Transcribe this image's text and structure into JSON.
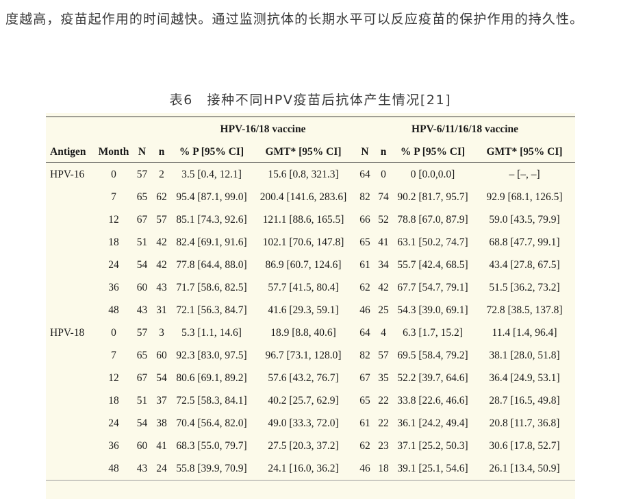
{
  "paragraph": "度越高，疫苗起作用的时间越快。通过监测抗体的长期水平可以反应疫苗的保护作用的持久性。",
  "caption": "表6　接种不同HPV疫苗后抗体产生情况[21]",
  "table": {
    "group_headers": [
      "HPV-16/18 vaccine",
      "HPV-6/11/16/18 vaccine"
    ],
    "columns": [
      "Antigen",
      "Month",
      "N",
      "n",
      "% P [95% CI]",
      "GMT* [95% CI]",
      "N",
      "n",
      "% P [95% CI]",
      "GMT* [95% CI]"
    ],
    "rows": [
      [
        "HPV-16",
        "0",
        "57",
        "2",
        "3.5 [0.4, 12.1]",
        "15.6 [0.8, 321.3]",
        "64",
        "0",
        "0 [0.0,0.0]",
        "– [–, –]"
      ],
      [
        "",
        "7",
        "65",
        "62",
        "95.4 [87.1, 99.0]",
        "200.4 [141.6, 283.6]",
        "82",
        "74",
        "90.2 [81.7, 95.7]",
        "92.9 [68.1, 126.5]"
      ],
      [
        "",
        "12",
        "67",
        "57",
        "85.1 [74.3, 92.6]",
        "121.1 [88.6, 165.5]",
        "66",
        "52",
        "78.8 [67.0, 87.9]",
        "59.0 [43.5, 79.9]"
      ],
      [
        "",
        "18",
        "51",
        "42",
        "82.4 [69.1, 91.6]",
        "102.1 [70.6, 147.8]",
        "65",
        "41",
        "63.1 [50.2, 74.7]",
        "68.8 [47.7, 99.1]"
      ],
      [
        "",
        "24",
        "54",
        "42",
        "77.8 [64.4, 88.0]",
        "86.9 [60.7, 124.6]",
        "61",
        "34",
        "55.7 [42.4, 68.5]",
        "43.4 [27.8, 67.5]"
      ],
      [
        "",
        "36",
        "60",
        "43",
        "71.7 [58.6, 82.5]",
        "57.7 [41.5, 80.4]",
        "62",
        "42",
        "67.7 [54.7, 79.1]",
        "51.5 [36.2, 73.2]"
      ],
      [
        "",
        "48",
        "43",
        "31",
        "72.1 [56.3, 84.7]",
        "41.6 [29.3, 59.1]",
        "46",
        "25",
        "54.3 [39.0, 69.1]",
        "72.8 [38.5, 137.8]"
      ],
      [
        "HPV-18",
        "0",
        "57",
        "3",
        "5.3 [1.1, 14.6]",
        "18.9 [8.8, 40.6]",
        "64",
        "4",
        "6.3 [1.7, 15.2]",
        "11.4 [1.4, 96.4]"
      ],
      [
        "",
        "7",
        "65",
        "60",
        "92.3 [83.0, 97.5]",
        "96.7 [73.1, 128.0]",
        "82",
        "57",
        "69.5 [58.4, 79.2]",
        "38.1 [28.0, 51.8]"
      ],
      [
        "",
        "12",
        "67",
        "54",
        "80.6 [69.1, 89.2]",
        "57.6 [43.2, 76.7]",
        "67",
        "35",
        "52.2 [39.7, 64.6]",
        "36.4 [24.9, 53.1]"
      ],
      [
        "",
        "18",
        "51",
        "37",
        "72.5 [58.3, 84.1]",
        "40.2 [25.7, 62.9]",
        "65",
        "22",
        "33.8 [22.6, 46.6]",
        "28.7 [16.5, 49.8]"
      ],
      [
        "",
        "24",
        "54",
        "38",
        "70.4 [56.4, 82.0]",
        "49.0 [33.3, 72.0]",
        "61",
        "22",
        "36.1 [24.2, 49.4]",
        "20.8 [11.7, 36.8]"
      ],
      [
        "",
        "36",
        "60",
        "41",
        "68.3 [55.0, 79.7]",
        "27.5 [20.3, 37.2]",
        "62",
        "23",
        "37.1 [25.2, 50.3]",
        "30.6 [17.8, 52.7]"
      ],
      [
        "",
        "48",
        "43",
        "24",
        "55.8 [39.9, 70.9]",
        "24.1 [16.0, 36.2]",
        "46",
        "18",
        "39.1 [25.1, 54.6]",
        "26.1 [13.4, 50.9]"
      ]
    ]
  }
}
